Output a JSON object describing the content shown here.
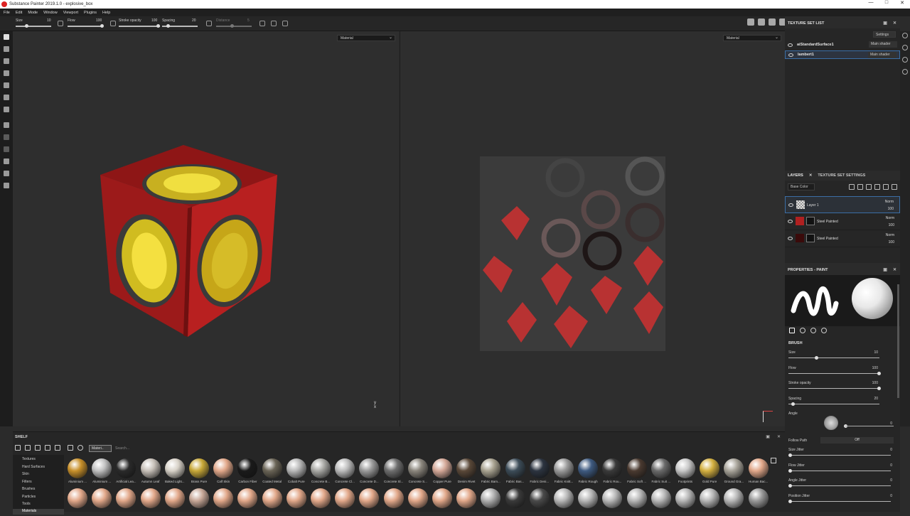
{
  "window": {
    "title": "Substance Painter 2019.1.0 - explosive_box",
    "controls": [
      "—",
      "□",
      "✕"
    ]
  },
  "menu": [
    "File",
    "Edit",
    "Mode",
    "Window",
    "Viewport",
    "Plugins",
    "Help"
  ],
  "tool_options": {
    "size_label": "Size",
    "size_value": "10",
    "flow_label": "Flow",
    "flow_value": "100",
    "stroke_opacity_label": "Stroke opacity",
    "stroke_opacity_value": "100",
    "spacing_label": "Spacing",
    "spacing_value": "20",
    "distance_label": "Distance",
    "distance_value": "5"
  },
  "viewport": {
    "left_mode": "Material",
    "right_mode": "Material"
  },
  "texture_set_list": {
    "title": "TEXTURE SET LIST",
    "settings_label": "Settings",
    "sets": [
      {
        "name": "aiStandardSurface1",
        "shader": "Main shader"
      },
      {
        "name": "lambert1",
        "shader": "Main shader"
      }
    ]
  },
  "layers_panel": {
    "tab_layers": "LAYERS",
    "tab_settings": "TEXTURE SET SETTINGS",
    "channel": "Base Color",
    "layers": [
      {
        "name": "Layer 1",
        "blend": "Norm",
        "opacity": "100"
      },
      {
        "name": "Steel Painted",
        "blend": "Norm",
        "opacity": "100"
      },
      {
        "name": "Steel Painted",
        "blend": "Norm",
        "opacity": "100"
      }
    ]
  },
  "properties": {
    "title": "PROPERTIES - PAINT",
    "section": "BRUSH",
    "params": [
      {
        "label": "Size",
        "value": "10",
        "level": 0.3
      },
      {
        "label": "Flow",
        "value": "100",
        "level": 1.0
      },
      {
        "label": "Stroke opacity",
        "value": "100",
        "level": 1.0
      },
      {
        "label": "Spacing",
        "value": "20",
        "level": 0.05
      }
    ],
    "angle_label": "Angle",
    "angle_value": "0",
    "follow_path_label": "Follow Path",
    "follow_path_value": "Off",
    "jitters": [
      {
        "label": "Size Jitter",
        "value": "0"
      },
      {
        "label": "Flow Jitter",
        "value": "0"
      },
      {
        "label": "Angle Jitter",
        "value": "0"
      },
      {
        "label": "Position Jitter",
        "value": "0"
      }
    ]
  },
  "shelf": {
    "title": "SHELF",
    "filter_tag": "Materi..",
    "search_placeholder": "Search...",
    "categories": [
      "Textures",
      "Hard Surfaces",
      "Skin",
      "Filters",
      "Brushes",
      "Particles",
      "Tools",
      "Materials"
    ],
    "selected_category": "Materials",
    "materials_row1": [
      {
        "name": "Aluminium ...",
        "color": "#c8902a"
      },
      {
        "name": "Aluminium ...",
        "color": "#c0c0c0"
      },
      {
        "name": "Artificial Lea...",
        "color": "#2a2a2a"
      },
      {
        "name": "Autumn Leaf",
        "color": "#c7c0b8"
      },
      {
        "name": "Baked Light...",
        "color": "#d8d2c8"
      },
      {
        "name": "Brass Pure",
        "color": "#c8a838"
      },
      {
        "name": "Calf Skin",
        "color": "#e2a88a"
      },
      {
        "name": "Carbon Fiber",
        "color": "#1a1a1a"
      },
      {
        "name": "Coated Metal",
        "color": "#6a6456"
      },
      {
        "name": "Cobalt Pure",
        "color": "#b8b8b8"
      },
      {
        "name": "Concrete B...",
        "color": "#a8a8a4"
      },
      {
        "name": "Concrete Cl...",
        "color": "#bcbcbc"
      },
      {
        "name": "Concrete D...",
        "color": "#9a9a9a"
      },
      {
        "name": "Concrete Sl...",
        "color": "#6e6e6e"
      },
      {
        "name": "Concrete S...",
        "color": "#8a857c"
      },
      {
        "name": "Copper Pure",
        "color": "#d4a898"
      },
      {
        "name": "Denim Rivet",
        "color": "#5a4838"
      },
      {
        "name": "Fabric Bam...",
        "color": "#a8a290"
      },
      {
        "name": "Fabric Bas...",
        "color": "#3c4c58"
      },
      {
        "name": "Fabric Deni...",
        "color": "#2c3440"
      },
      {
        "name": "Fabric Knitt...",
        "color": "#9a9a9a"
      },
      {
        "name": "Fabric Rough",
        "color": "#3e5a80"
      },
      {
        "name": "Fabric Rou...",
        "color": "#3a3a3a"
      },
      {
        "name": "Fabric Soft ...",
        "color": "#4a3a30"
      },
      {
        "name": "Fabric Suit ...",
        "color": "#6a6a6a"
      },
      {
        "name": "Footprints",
        "color": "#c8c8c8"
      },
      {
        "name": "Gold Pure",
        "color": "#d4b040"
      },
      {
        "name": "Ground Gra...",
        "color": "#a8a49a"
      },
      {
        "name": "Human Bac...",
        "color": "#e2a88a"
      }
    ],
    "materials_row2_colors": [
      "#e2a88a",
      "#e2a88a",
      "#e2a88a",
      "#e2a88a",
      "#e2a88a",
      "#c8a898",
      "#e2a88a",
      "#e2a88a",
      "#e2a88a",
      "#e2a88a",
      "#e2a88a",
      "#e2a88a",
      "#e2a88a",
      "#e2a88a",
      "#e2a88a",
      "#e2a88a",
      "#e2a88a",
      "#b0b0b0",
      "#3a3a3a",
      "#4a4a4a",
      "#b8b8b8",
      "#b8b8b8",
      "#b8b8b8",
      "#b8b8b8",
      "#b8b8b8",
      "#b8b8b8",
      "#b8b8b8",
      "#b8b8b8",
      "#9a9a9a"
    ]
  }
}
